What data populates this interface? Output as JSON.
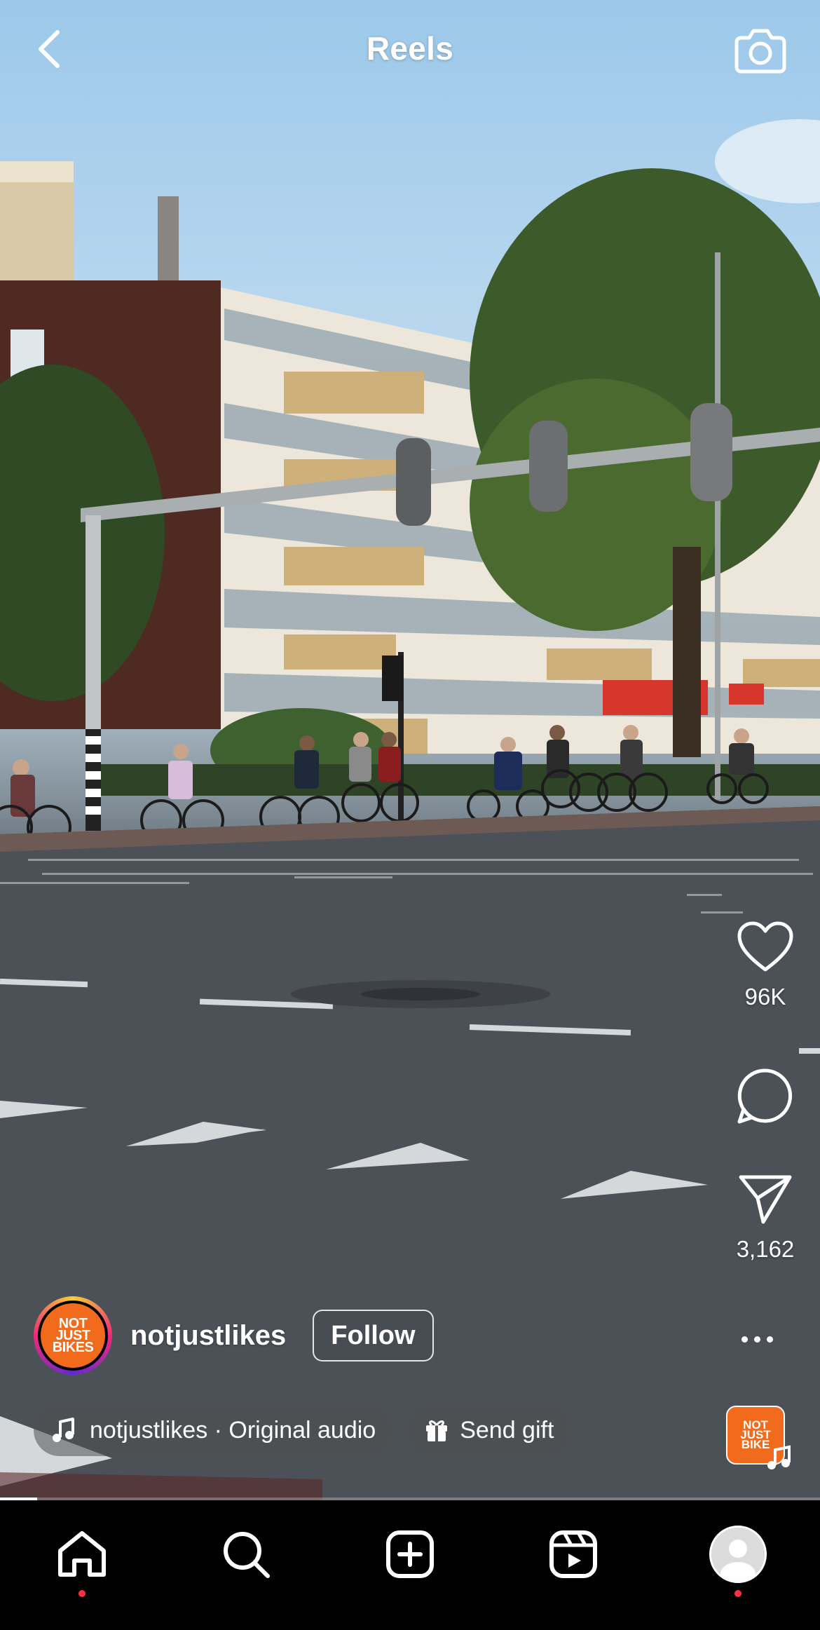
{
  "header": {
    "title": "Reels",
    "back_icon": "chevron-left-icon",
    "camera_icon": "camera-icon"
  },
  "actions": {
    "likes": "96K",
    "shares": "3,162",
    "like_icon": "heart-icon",
    "comment_icon": "comment-icon",
    "share_icon": "send-icon",
    "more_icon": "more-horizontal-icon"
  },
  "author": {
    "username": "notjustlikes",
    "follow_label": "Follow",
    "avatar_text": [
      "NOT",
      "JUST",
      "BIKES"
    ]
  },
  "audio": {
    "label": "notjustlikes · Original audio",
    "gift_label": "Send gift",
    "thumb_text": [
      "NOT",
      "JUST",
      "BIKE"
    ]
  },
  "progress": 0.045,
  "nav": {
    "items": [
      "home-icon",
      "search-icon",
      "create-icon",
      "reels-icon",
      "profile-avatar"
    ],
    "notification_dots": [
      "home",
      "profile"
    ]
  },
  "colors": {
    "brand_orange": "#f26a1b",
    "notification": "#ff3040",
    "background": "#000000"
  }
}
